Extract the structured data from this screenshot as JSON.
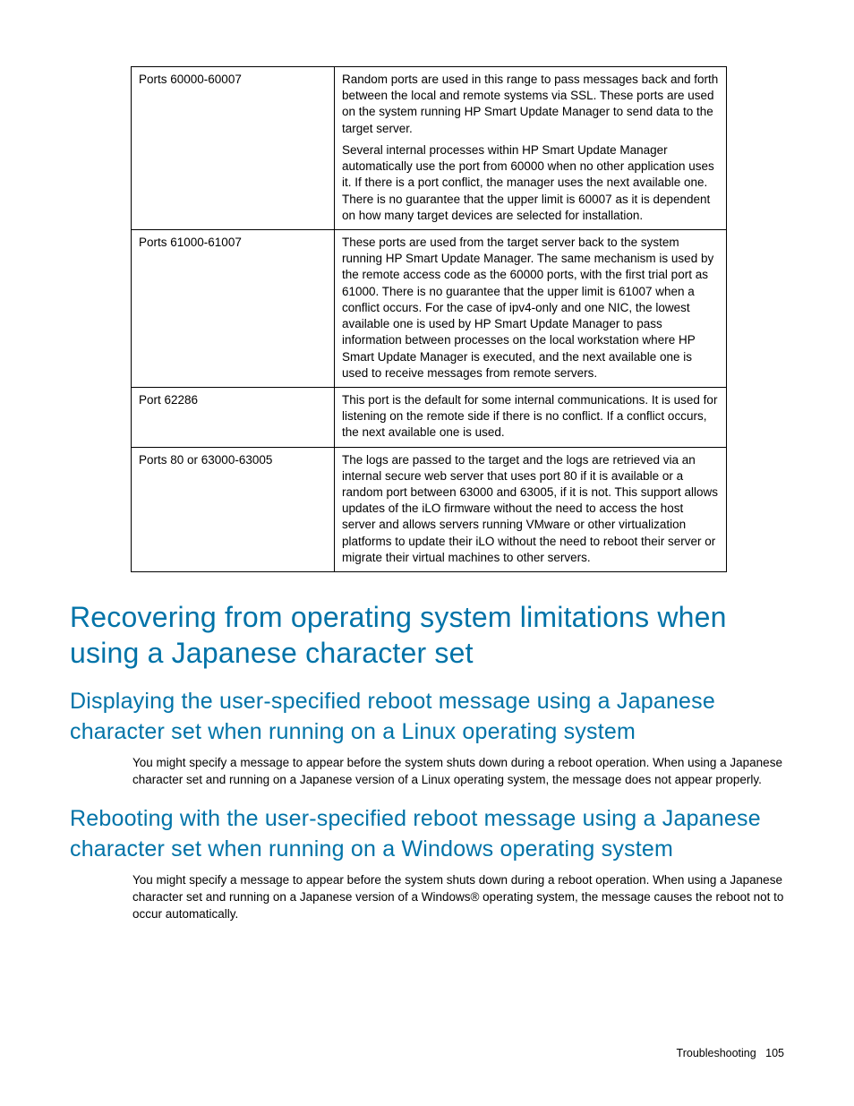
{
  "table": {
    "rows": [
      {
        "port": "Ports 60000-60007",
        "desc": [
          "Random ports are used in this range to pass messages back and forth between the local and remote systems via SSL. These ports are used on the system running HP Smart Update Manager to send data to the target server.",
          "Several internal processes within HP Smart Update Manager automatically use the port from 60000 when no other application uses it. If there is a port conflict, the manager uses the next available one. There is no guarantee that the upper limit is 60007 as it is dependent on how many target devices are selected for installation."
        ]
      },
      {
        "port": "Ports 61000-61007",
        "desc": [
          "These ports are used from the target server back to the system running HP Smart Update Manager. The same mechanism is used by the remote access code as the 60000 ports, with the first trial port as 61000. There is no guarantee that the upper limit is 61007 when a conflict occurs. For the case of ipv4-only and one NIC, the lowest available one is used by HP Smart Update Manager to pass information between processes on the local workstation where HP Smart Update Manager is executed, and the next available one is used to receive messages from remote servers."
        ]
      },
      {
        "port": "Port 62286",
        "desc": [
          "This port is the default for some internal communications. It is used for listening on the remote side if there is no conflict. If a conflict occurs, the next available one is used."
        ]
      },
      {
        "port": "Ports 80 or 63000-63005",
        "desc": [
          "The logs are passed to the target and the logs are retrieved via an internal secure web server that uses port 80 if it is available or a random port between 63000 and 63005, if it is not. This support allows updates of the iLO firmware without the need to access the host server and allows servers running VMware or other virtualization platforms to update their iLO without the need to reboot their server or migrate their virtual machines to other servers."
        ]
      }
    ]
  },
  "h1": "Recovering from operating system limitations when using a Japanese character set",
  "sub1": {
    "title": "Displaying the user-specified reboot message using a Japanese character set when running on a Linux operating system",
    "body": "You might specify a message to appear before the system shuts down during a reboot operation. When using a Japanese character set and running on a Japanese version of a Linux operating system, the message does not appear properly."
  },
  "sub2": {
    "title": "Rebooting with the user-specified reboot message using a Japanese character set when running on a Windows operating system",
    "body": "You might specify a message to appear before the system shuts down during a reboot operation. When using a Japanese character set and running on a Japanese version of a Windows® operating system, the message causes the reboot not to occur automatically."
  },
  "footer": {
    "section": "Troubleshooting",
    "page": "105"
  }
}
